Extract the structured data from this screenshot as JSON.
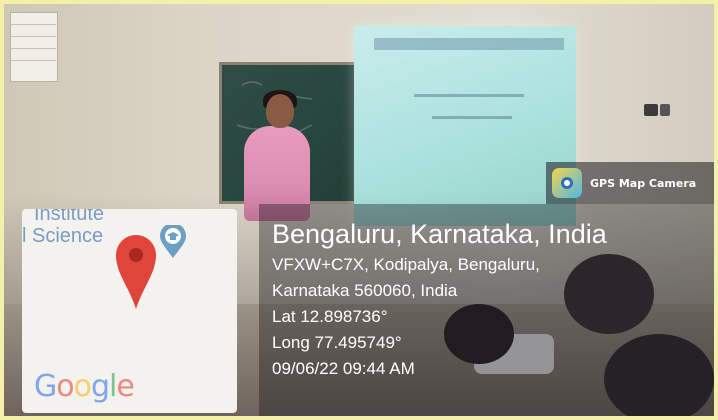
{
  "badge": {
    "app_name": "GPS Map Camera",
    "icon": "gps-map-camera-logo"
  },
  "map": {
    "label_line1": "Institute",
    "label_line2": "l Science",
    "brand": [
      "G",
      "o",
      "o",
      "g",
      "l",
      "e"
    ],
    "pin_icon": "map-pin-icon",
    "poi_icon": "school-poi-icon"
  },
  "location": {
    "city": "Bengaluru, Karnataka, India",
    "address_line1": "VFXW+C7X, Kodipalya, Bengaluru,",
    "address_line2": "Karnataka 560060, India",
    "lat": "Lat 12.898736°",
    "long": "Long 77.495749°",
    "datetime": "09/06/22 09:44 AM"
  },
  "colors": {
    "border": "#f5f0a8",
    "pin_red": "#e0453a",
    "poi_blue": "#6d9ec4"
  }
}
